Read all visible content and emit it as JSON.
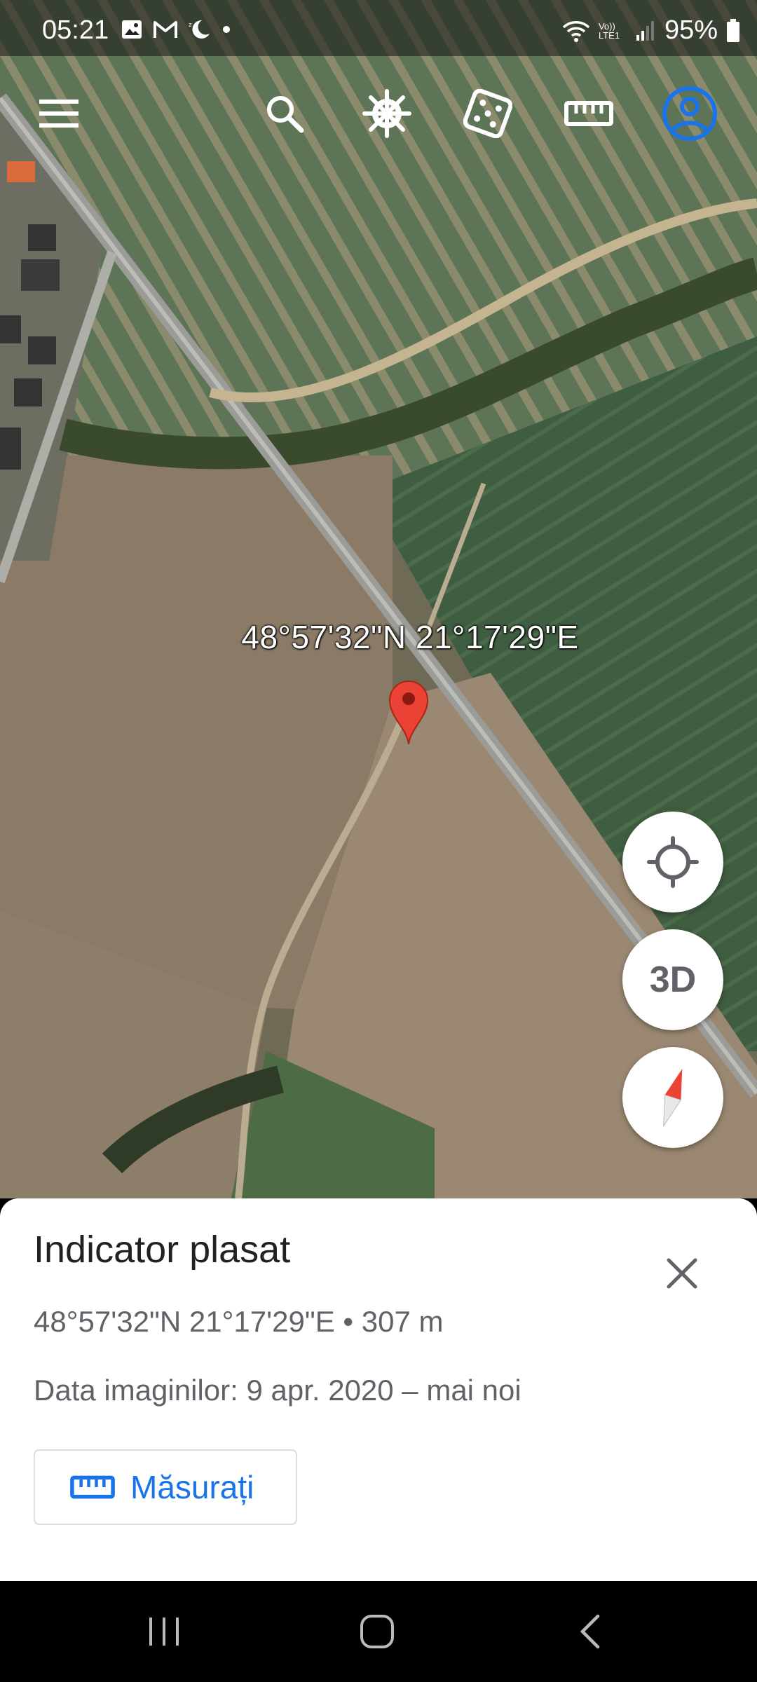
{
  "status_bar": {
    "time": "05:21",
    "left_icons": [
      "image-icon",
      "gmail-icon",
      "moon-icon",
      "dot-icon"
    ],
    "right_icons": [
      "wifi-icon",
      "volte-icon",
      "signal-icon"
    ],
    "volte_text": "Vo)) LTE1",
    "battery": "95%"
  },
  "toolbar": {
    "items": [
      "menu-icon",
      "search-icon",
      "voyager-helm-icon",
      "dice-icon",
      "ruler-icon",
      "account-icon"
    ],
    "accent": "#1a73e8"
  },
  "map": {
    "coordinate_label": "48°57'32\"N 21°17'29\"E",
    "pin_color": "#ea4335"
  },
  "fabs": {
    "my_location": "crosshair-icon",
    "three_d_label": "3D",
    "compass": "compass-icon"
  },
  "sheet": {
    "title": "Indicator plasat",
    "coords": "48°57'32\"N 21°17'29\"E • 307 m",
    "date": "Data imaginilor: 9 apr. 2020 – mai noi",
    "measure_label": "Măsurați"
  },
  "nav_bar": {
    "items": [
      "recents-icon",
      "home-icon",
      "back-icon"
    ]
  }
}
